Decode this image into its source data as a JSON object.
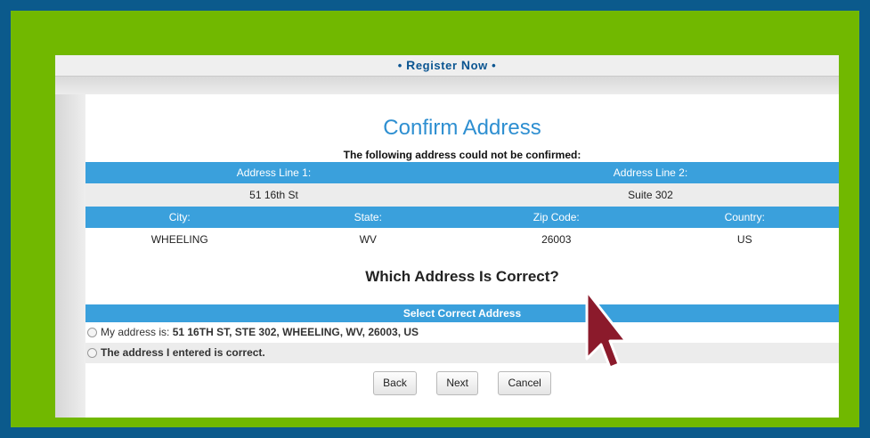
{
  "header": {
    "bullet_left": "• ",
    "register_R": "R",
    "register_rest": "egister ",
    "now_N": "N",
    "now_rest": "ow",
    "bullet_right": " •"
  },
  "page": {
    "title": "Confirm Address",
    "subtitle": "The following address could not be confirmed:"
  },
  "address_table": {
    "line1_header": "Address Line 1:",
    "line2_header": "Address Line 2:",
    "line1_value": "51 16th St",
    "line2_value": "Suite 302",
    "city_header": "City:",
    "state_header": "State:",
    "zip_header": "Zip Code:",
    "country_header": "Country:",
    "city_value": "WHEELING",
    "state_value": "WV",
    "zip_value": "26003",
    "country_value": "US"
  },
  "question": "Which Address Is Correct?",
  "select": {
    "header": "Select Correct Address",
    "option1_prefix": "My address is: ",
    "option1_value": "51 16TH ST, STE 302, WHEELING, WV, 26003, US",
    "option2": "The address I entered is correct."
  },
  "buttons": {
    "back": "Back",
    "next": "Next",
    "cancel": "Cancel"
  },
  "colors": {
    "outer_border": "#0b5a8c",
    "green_frame": "#71b800",
    "table_header": "#3aa0dc",
    "title": "#2e8fd1",
    "cursor": "#8b1a2b"
  },
  "icons": {
    "cursor": "arrow-cursor-icon",
    "radio": "radio-button-icon"
  }
}
